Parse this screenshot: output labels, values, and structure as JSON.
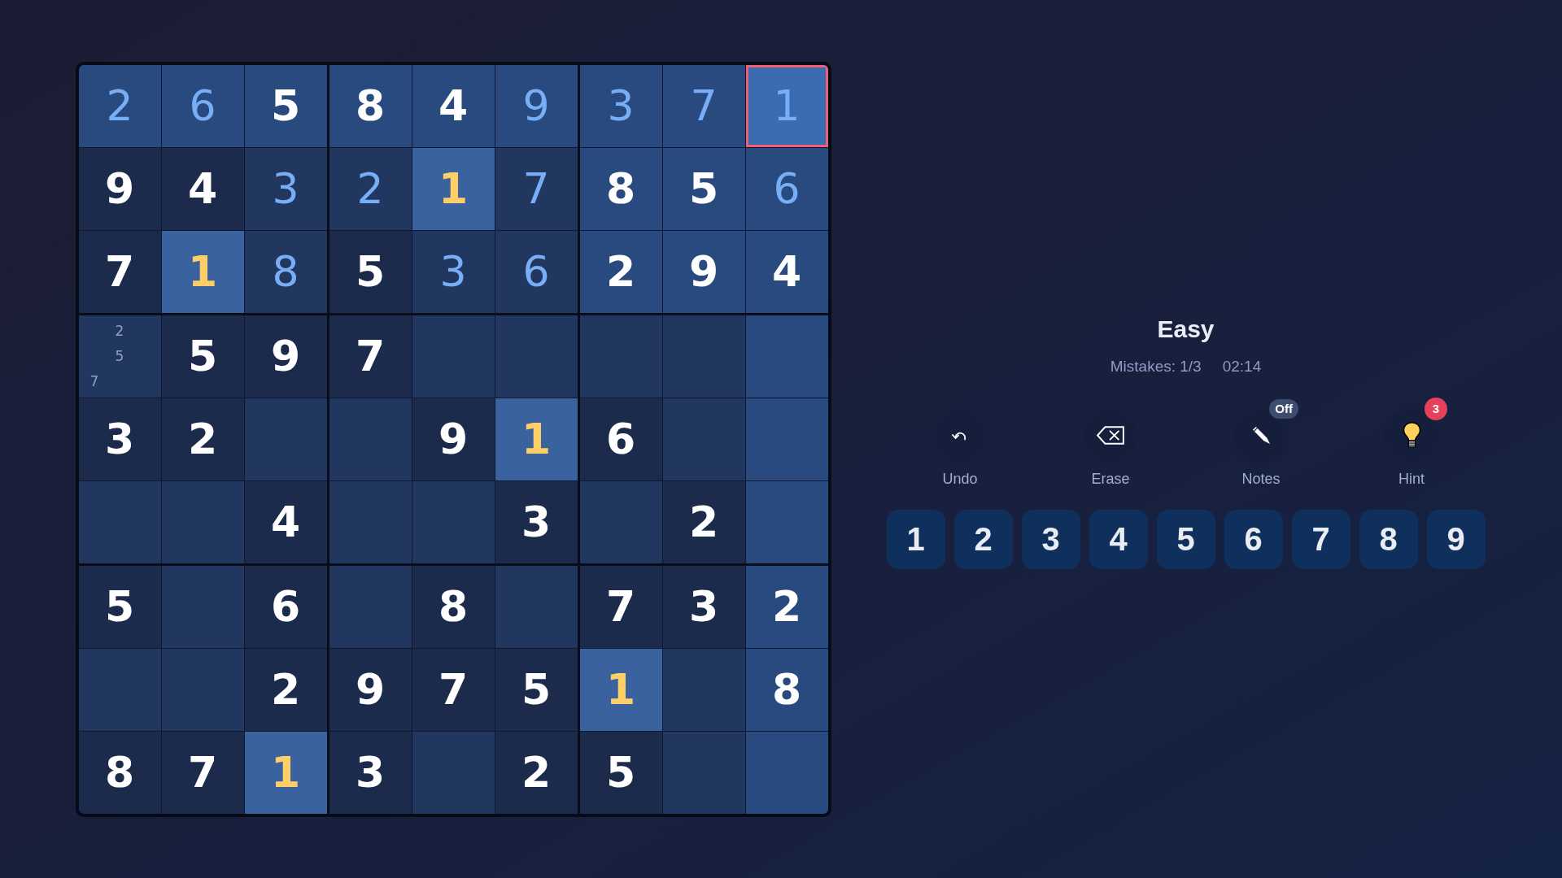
{
  "board": {
    "rows": [
      [
        {
          "kind": "entered",
          "value": "2",
          "selected": false,
          "highlighted": true,
          "matching": false
        },
        {
          "kind": "entered",
          "value": "6",
          "selected": false,
          "highlighted": true,
          "matching": false
        },
        {
          "kind": "given",
          "value": "5",
          "selected": false,
          "highlighted": true,
          "matching": false
        },
        {
          "kind": "given",
          "value": "8",
          "selected": false,
          "highlighted": true,
          "matching": false
        },
        {
          "kind": "given",
          "value": "4",
          "selected": false,
          "highlighted": true,
          "matching": false
        },
        {
          "kind": "entered",
          "value": "9",
          "selected": false,
          "highlighted": true,
          "matching": false
        },
        {
          "kind": "entered",
          "value": "3",
          "selected": false,
          "highlighted": true,
          "matching": false
        },
        {
          "kind": "entered",
          "value": "7",
          "selected": false,
          "highlighted": true,
          "matching": false
        },
        {
          "kind": "entered",
          "value": "1",
          "selected": true,
          "highlighted": true,
          "matching": false
        }
      ],
      [
        {
          "kind": "given",
          "value": "9",
          "selected": false,
          "highlighted": false,
          "matching": false
        },
        {
          "kind": "given",
          "value": "4",
          "selected": false,
          "highlighted": false,
          "matching": false
        },
        {
          "kind": "entered",
          "value": "3",
          "selected": false,
          "highlighted": false,
          "matching": false
        },
        {
          "kind": "entered",
          "value": "2",
          "selected": false,
          "highlighted": false,
          "matching": false
        },
        {
          "kind": "given",
          "value": "1",
          "selected": false,
          "highlighted": false,
          "matching": true
        },
        {
          "kind": "entered",
          "value": "7",
          "selected": false,
          "highlighted": false,
          "matching": false
        },
        {
          "kind": "given",
          "value": "8",
          "selected": false,
          "highlighted": true,
          "matching": false
        },
        {
          "kind": "given",
          "value": "5",
          "selected": false,
          "highlighted": true,
          "matching": false
        },
        {
          "kind": "entered",
          "value": "6",
          "selected": false,
          "highlighted": true,
          "matching": false
        }
      ],
      [
        {
          "kind": "given",
          "value": "7",
          "selected": false,
          "highlighted": false,
          "matching": false
        },
        {
          "kind": "given",
          "value": "1",
          "selected": false,
          "highlighted": false,
          "matching": true
        },
        {
          "kind": "entered",
          "value": "8",
          "selected": false,
          "highlighted": false,
          "matching": false
        },
        {
          "kind": "given",
          "value": "5",
          "selected": false,
          "highlighted": false,
          "matching": false
        },
        {
          "kind": "entered",
          "value": "3",
          "selected": false,
          "highlighted": false,
          "matching": false
        },
        {
          "kind": "entered",
          "value": "6",
          "selected": false,
          "highlighted": false,
          "matching": false
        },
        {
          "kind": "given",
          "value": "2",
          "selected": false,
          "highlighted": true,
          "matching": false
        },
        {
          "kind": "given",
          "value": "9",
          "selected": false,
          "highlighted": true,
          "matching": false
        },
        {
          "kind": "given",
          "value": "4",
          "selected": false,
          "highlighted": true,
          "matching": false
        }
      ],
      [
        {
          "kind": "notes",
          "notes": [
            "2",
            "5",
            "7"
          ],
          "selected": false,
          "highlighted": false,
          "matching": false
        },
        {
          "kind": "given",
          "value": "5",
          "selected": false,
          "highlighted": false,
          "matching": false
        },
        {
          "kind": "given",
          "value": "9",
          "selected": false,
          "highlighted": false,
          "matching": false
        },
        {
          "kind": "given",
          "value": "7",
          "selected": false,
          "highlighted": false,
          "matching": false
        },
        {
          "kind": "empty",
          "selected": false,
          "highlighted": false,
          "matching": false
        },
        {
          "kind": "empty",
          "selected": false,
          "highlighted": false,
          "matching": false
        },
        {
          "kind": "empty",
          "selected": false,
          "highlighted": false,
          "matching": false
        },
        {
          "kind": "empty",
          "selected": false,
          "highlighted": false,
          "matching": false
        },
        {
          "kind": "empty",
          "selected": false,
          "highlighted": true,
          "matching": false
        }
      ],
      [
        {
          "kind": "given",
          "value": "3",
          "selected": false,
          "highlighted": false,
          "matching": false
        },
        {
          "kind": "given",
          "value": "2",
          "selected": false,
          "highlighted": false,
          "matching": false
        },
        {
          "kind": "empty",
          "selected": false,
          "highlighted": false,
          "matching": false
        },
        {
          "kind": "empty",
          "selected": false,
          "highlighted": false,
          "matching": false
        },
        {
          "kind": "given",
          "value": "9",
          "selected": false,
          "highlighted": false,
          "matching": false
        },
        {
          "kind": "given",
          "value": "1",
          "selected": false,
          "highlighted": false,
          "matching": true
        },
        {
          "kind": "given",
          "value": "6",
          "selected": false,
          "highlighted": false,
          "matching": false
        },
        {
          "kind": "empty",
          "selected": false,
          "highlighted": false,
          "matching": false
        },
        {
          "kind": "empty",
          "selected": false,
          "highlighted": true,
          "matching": false
        }
      ],
      [
        {
          "kind": "empty",
          "selected": false,
          "highlighted": false,
          "matching": false
        },
        {
          "kind": "empty",
          "selected": false,
          "highlighted": false,
          "matching": false
        },
        {
          "kind": "given",
          "value": "4",
          "selected": false,
          "highlighted": false,
          "matching": false
        },
        {
          "kind": "empty",
          "selected": false,
          "highlighted": false,
          "matching": false
        },
        {
          "kind": "empty",
          "selected": false,
          "highlighted": false,
          "matching": false
        },
        {
          "kind": "given",
          "value": "3",
          "selected": false,
          "highlighted": false,
          "matching": false
        },
        {
          "kind": "empty",
          "selected": false,
          "highlighted": false,
          "matching": false
        },
        {
          "kind": "given",
          "value": "2",
          "selected": false,
          "highlighted": false,
          "matching": false
        },
        {
          "kind": "empty",
          "selected": false,
          "highlighted": true,
          "matching": false
        }
      ],
      [
        {
          "kind": "given",
          "value": "5",
          "selected": false,
          "highlighted": false,
          "matching": false
        },
        {
          "kind": "empty",
          "selected": false,
          "highlighted": false,
          "matching": false
        },
        {
          "kind": "given",
          "value": "6",
          "selected": false,
          "highlighted": false,
          "matching": false
        },
        {
          "kind": "empty",
          "selected": false,
          "highlighted": false,
          "matching": false
        },
        {
          "kind": "given",
          "value": "8",
          "selected": false,
          "highlighted": false,
          "matching": false
        },
        {
          "kind": "empty",
          "selected": false,
          "highlighted": false,
          "matching": false
        },
        {
          "kind": "given",
          "value": "7",
          "selected": false,
          "highlighted": false,
          "matching": false
        },
        {
          "kind": "given",
          "value": "3",
          "selected": false,
          "highlighted": false,
          "matching": false
        },
        {
          "kind": "given",
          "value": "2",
          "selected": false,
          "highlighted": true,
          "matching": false
        }
      ],
      [
        {
          "kind": "empty",
          "selected": false,
          "highlighted": false,
          "matching": false
        },
        {
          "kind": "empty",
          "selected": false,
          "highlighted": false,
          "matching": false
        },
        {
          "kind": "given",
          "value": "2",
          "selected": false,
          "highlighted": false,
          "matching": false
        },
        {
          "kind": "given",
          "value": "9",
          "selected": false,
          "highlighted": false,
          "matching": false
        },
        {
          "kind": "given",
          "value": "7",
          "selected": false,
          "highlighted": false,
          "matching": false
        },
        {
          "kind": "given",
          "value": "5",
          "selected": false,
          "highlighted": false,
          "matching": false
        },
        {
          "kind": "given",
          "value": "1",
          "selected": false,
          "highlighted": false,
          "matching": true
        },
        {
          "kind": "empty",
          "selected": false,
          "highlighted": false,
          "matching": false
        },
        {
          "kind": "given",
          "value": "8",
          "selected": false,
          "highlighted": true,
          "matching": false
        }
      ],
      [
        {
          "kind": "given",
          "value": "8",
          "selected": false,
          "highlighted": false,
          "matching": false
        },
        {
          "kind": "given",
          "value": "7",
          "selected": false,
          "highlighted": false,
          "matching": false
        },
        {
          "kind": "given",
          "value": "1",
          "selected": false,
          "highlighted": false,
          "matching": true
        },
        {
          "kind": "given",
          "value": "3",
          "selected": false,
          "highlighted": false,
          "matching": false
        },
        {
          "kind": "empty",
          "selected": false,
          "highlighted": false,
          "matching": false
        },
        {
          "kind": "given",
          "value": "2",
          "selected": false,
          "highlighted": false,
          "matching": false
        },
        {
          "kind": "given",
          "value": "5",
          "selected": false,
          "highlighted": false,
          "matching": false
        },
        {
          "kind": "empty",
          "selected": false,
          "highlighted": false,
          "matching": false
        },
        {
          "kind": "empty",
          "selected": false,
          "highlighted": true,
          "matching": false
        }
      ]
    ]
  },
  "game": {
    "difficulty": "Easy",
    "mistakes": "Mistakes: 1/3",
    "timer": "02:14"
  },
  "tools": [
    {
      "kind": "undo",
      "label": "Undo"
    },
    {
      "kind": "erase",
      "label": "Erase"
    },
    {
      "kind": "notes",
      "label": "Notes",
      "badge": {
        "kind": "status",
        "text": "Off"
      }
    },
    {
      "kind": "hint",
      "label": "Hint",
      "badge": {
        "kind": "count",
        "text": "3"
      }
    }
  ],
  "number_pad": [
    "1",
    "2",
    "3",
    "4",
    "5",
    "6",
    "7",
    "8",
    "9"
  ]
}
